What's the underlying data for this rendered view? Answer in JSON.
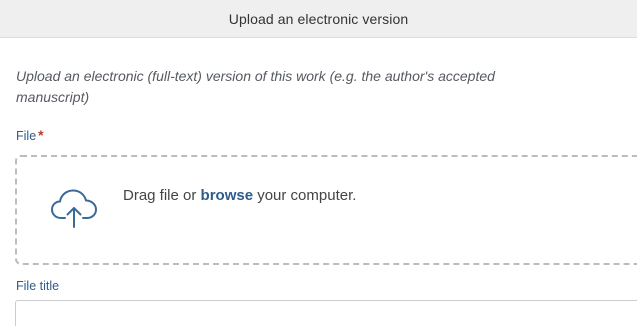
{
  "header": {
    "title": "Upload an electronic version"
  },
  "instructions": {
    "line1": "Upload an electronic (full-text) version of this work (e.g. the author's accepted",
    "line2": "manuscript)"
  },
  "file_field": {
    "label": "File",
    "required_mark": "*"
  },
  "dropzone": {
    "icon": "cloud-upload-icon",
    "text_before": "Drag file or ",
    "browse_label": "browse",
    "text_after": " your computer."
  },
  "file_title_field": {
    "label": "File title",
    "value": "",
    "placeholder": ""
  },
  "colors": {
    "link": "#2f5c8a",
    "required": "#c0392b",
    "header_bg": "#efefef",
    "dashed_border": "#b9bcc2"
  }
}
